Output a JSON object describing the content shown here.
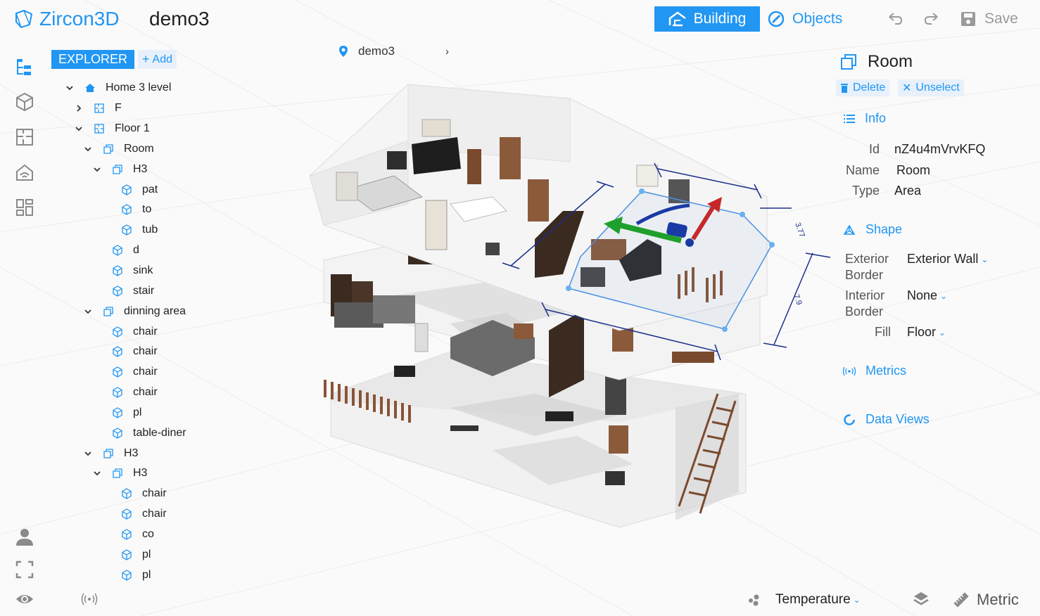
{
  "app": {
    "name": "Zircon3D",
    "project": "demo3"
  },
  "header": {
    "building_label": "Building",
    "objects_label": "Objects",
    "save_label": "Save"
  },
  "explorer": {
    "tab_label": "EXPLORER",
    "add_label": "Add",
    "tree": [
      {
        "label": "Home 3 level",
        "level": 0,
        "expand": "down",
        "icon": "home-icon"
      },
      {
        "label": "F",
        "level": 1,
        "expand": "right",
        "icon": "floor-plan-icon"
      },
      {
        "label": "Floor 1",
        "level": 1,
        "expand": "down",
        "icon": "floor-plan-icon"
      },
      {
        "label": "Room",
        "level": 2,
        "expand": "down",
        "icon": "room-icon"
      },
      {
        "label": "H3",
        "level": 3,
        "expand": "down",
        "icon": "room-icon"
      },
      {
        "label": "pat",
        "level": 4,
        "expand": "",
        "icon": "cube-icon"
      },
      {
        "label": "to",
        "level": 4,
        "expand": "",
        "icon": "cube-icon"
      },
      {
        "label": "tub",
        "level": 4,
        "expand": "",
        "icon": "cube-icon"
      },
      {
        "label": "d",
        "level": 3,
        "expand": "",
        "icon": "cube-icon"
      },
      {
        "label": "sink",
        "level": 3,
        "expand": "",
        "icon": "cube-icon"
      },
      {
        "label": "stair",
        "level": 3,
        "expand": "",
        "icon": "cube-icon"
      },
      {
        "label": "dinning area",
        "level": 2,
        "expand": "down",
        "icon": "room-icon"
      },
      {
        "label": "chair",
        "level": 3,
        "expand": "",
        "icon": "cube-icon"
      },
      {
        "label": "chair",
        "level": 3,
        "expand": "",
        "icon": "cube-icon"
      },
      {
        "label": "chair",
        "level": 3,
        "expand": "",
        "icon": "cube-icon"
      },
      {
        "label": "chair",
        "level": 3,
        "expand": "",
        "icon": "cube-icon"
      },
      {
        "label": "pl",
        "level": 3,
        "expand": "",
        "icon": "cube-icon"
      },
      {
        "label": "table-diner",
        "level": 3,
        "expand": "",
        "icon": "cube-icon"
      },
      {
        "label": "H3",
        "level": 2,
        "expand": "down",
        "icon": "room-icon"
      },
      {
        "label": "H3",
        "level": 3,
        "expand": "down",
        "icon": "room-icon"
      },
      {
        "label": "chair",
        "level": 4,
        "expand": "",
        "icon": "cube-icon"
      },
      {
        "label": "chair",
        "level": 4,
        "expand": "",
        "icon": "cube-icon"
      },
      {
        "label": "co",
        "level": 4,
        "expand": "",
        "icon": "cube-icon"
      },
      {
        "label": "pl",
        "level": 4,
        "expand": "",
        "icon": "cube-icon"
      },
      {
        "label": "pl",
        "level": 4,
        "expand": "",
        "icon": "cube-icon"
      }
    ]
  },
  "breadcrumb": {
    "item": "demo3"
  },
  "viewport": {
    "dimension_labels": [
      "3.77",
      "7.9"
    ],
    "colors": {
      "selection": "#4a90e2",
      "axis_x": "#1fa02c",
      "axis_y": "#c62828",
      "axis_z": "#1a3aa6",
      "dimension": "#1a2f8a"
    }
  },
  "panel": {
    "title": "Room",
    "delete_label": "Delete",
    "unselect_label": "Unselect",
    "info_label": "Info",
    "id_key": "Id",
    "id_value": "nZ4u4mVrvKFQ",
    "name_key": "Name",
    "name_value": "Room",
    "type_key": "Type",
    "type_value": "Area",
    "shape_label": "Shape",
    "exterior_key_1": "Exterior",
    "exterior_key_2": "Border",
    "exterior_value": "Exterior Wall",
    "interior_key_1": "Interior",
    "interior_key_2": "Border",
    "interior_value": "None",
    "fill_key": "Fill",
    "fill_value": "Floor",
    "metrics_label": "Metrics",
    "dataviews_label": "Data Views"
  },
  "bottom": {
    "temperature_label": "Temperature",
    "metric_label": "Metric"
  },
  "theme": {
    "accent": "#2196f3"
  }
}
